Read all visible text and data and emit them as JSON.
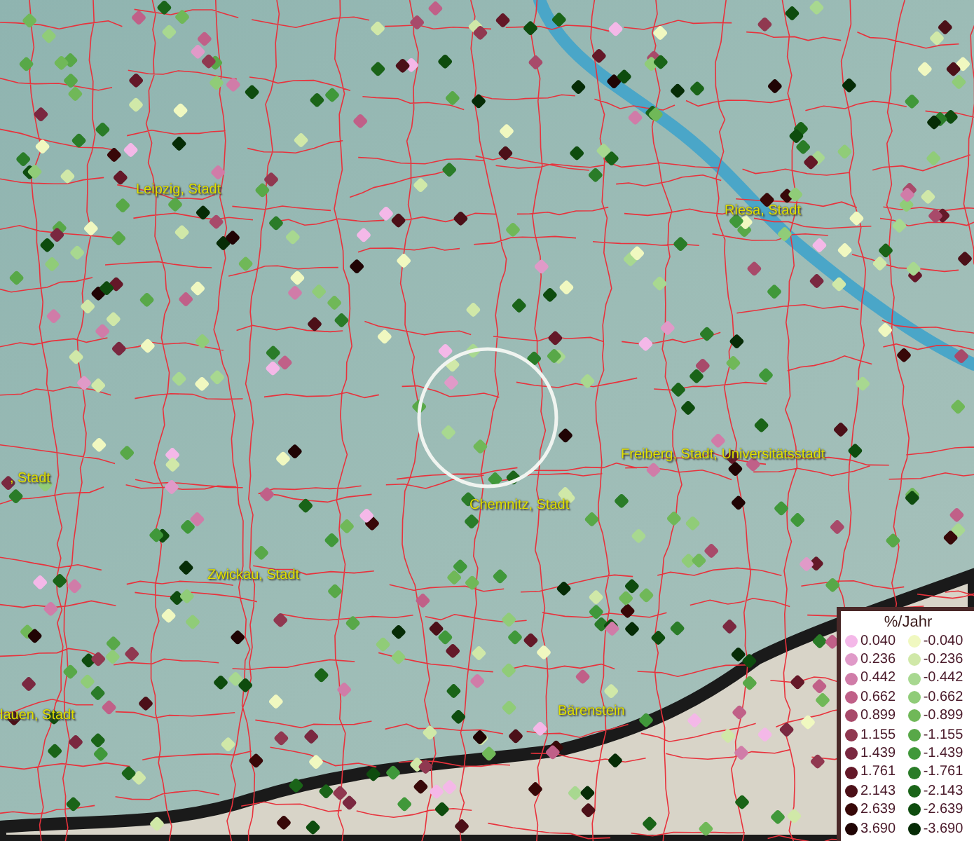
{
  "map": {
    "places": [
      {
        "name": "Leipzig, Stadt"
      },
      {
        "name": "Riesa, Stadt"
      },
      {
        "name": ", Stadt"
      },
      {
        "name": "Freiberg, Stadt, Universitätsstadt"
      },
      {
        "name": "Chemnitz, Stadt"
      },
      {
        "name": "Zwickau, Stadt"
      },
      {
        "name": "lauen, Stadt"
      },
      {
        "name": "Bärenstein"
      }
    ]
  },
  "legend": {
    "title": "%/Jahr",
    "rows": [
      {
        "left": {
          "label": "0.040",
          "color": "#f4b8e8"
        },
        "right": {
          "label": "-0.040",
          "color": "#f0f8c0"
        }
      },
      {
        "left": {
          "label": "0.236",
          "color": "#e09ac8"
        },
        "right": {
          "label": "-0.236",
          "color": "#d0e8a8"
        }
      },
      {
        "left": {
          "label": "0.442",
          "color": "#d07ca8"
        },
        "right": {
          "label": "-0.442",
          "color": "#a8d890"
        }
      },
      {
        "left": {
          "label": "0.662",
          "color": "#c06088"
        },
        "right": {
          "label": "-0.662",
          "color": "#90cc78"
        }
      },
      {
        "left": {
          "label": "0.899",
          "color": "#a84a6a"
        },
        "right": {
          "label": "-0.899",
          "color": "#70b858"
        }
      },
      {
        "left": {
          "label": "1.155",
          "color": "#903850"
        },
        "right": {
          "label": "-1.155",
          "color": "#58a848"
        }
      },
      {
        "left": {
          "label": "1.439",
          "color": "#7a2840"
        },
        "right": {
          "label": "-1.439",
          "color": "#40983a"
        }
      },
      {
        "left": {
          "label": "1.761",
          "color": "#641828"
        },
        "right": {
          "label": "-1.761",
          "color": "#2a7c28"
        }
      },
      {
        "left": {
          "label": "2.143",
          "color": "#4c1018"
        },
        "right": {
          "label": "-2.143",
          "color": "#1a6418"
        }
      },
      {
        "left": {
          "label": "2.639",
          "color": "#380808"
        },
        "right": {
          "label": "-2.639",
          "color": "#0e4c0e"
        }
      },
      {
        "left": {
          "label": "3.690",
          "color": "#200404"
        },
        "right": {
          "label": "-3.690",
          "color": "#062c06"
        }
      }
    ]
  }
}
